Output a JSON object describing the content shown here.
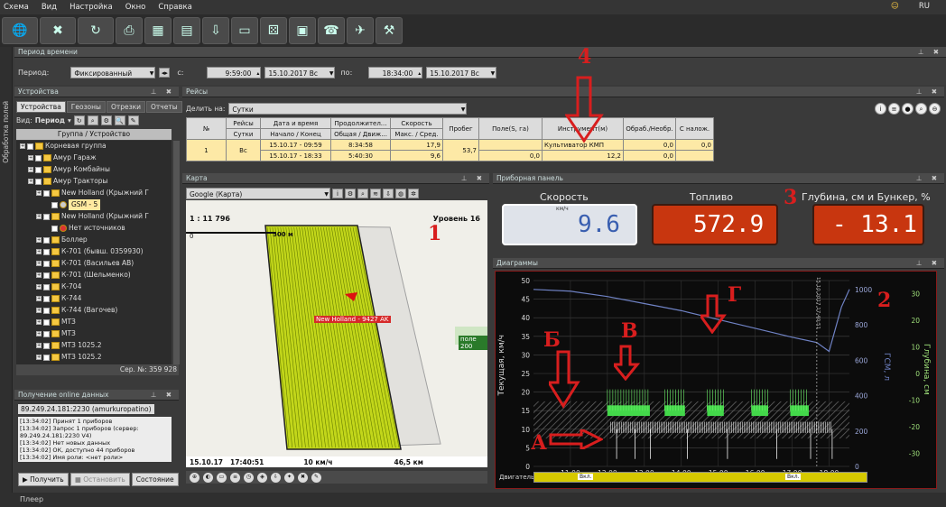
{
  "menu": {
    "items": [
      "Схема",
      "Вид",
      "Настройка",
      "Окно",
      "Справка"
    ],
    "lang": "RU"
  },
  "side_tab": "Обработка полей",
  "period_panel": {
    "title": "Период времени",
    "label": "Период:",
    "mode": "Фиксированный",
    "from_label": "с:",
    "from_time": "9:59:00",
    "from_date": "15.10.2017 Вс",
    "to_label": "по:",
    "to_time": "18:34:00",
    "to_date": "15.10.2017 Вс"
  },
  "devices_panel": {
    "title": "Устройства",
    "tabs": [
      "Устройства",
      "Геозоны",
      "Отрезки",
      "Отчеты"
    ],
    "view_label": "Вид:",
    "view_value": "Период",
    "group_header": "Группа / Устройство",
    "tree": [
      {
        "label": "Корневая группа",
        "level": 0
      },
      {
        "label": "Амур Гараж",
        "level": 1
      },
      {
        "label": "Амур Комбайны",
        "level": 1
      },
      {
        "label": "Амур Тракторы",
        "level": 1
      },
      {
        "label": "New Holland (Крыжний Г",
        "level": 2
      },
      {
        "label": "GSM - 5",
        "level": 3,
        "selected": true
      },
      {
        "label": "New Holland (Крыжний Г",
        "level": 2
      },
      {
        "label": "Нет источников",
        "level": 3
      },
      {
        "label": "Боллер",
        "level": 2
      },
      {
        "label": "К-701 (бывш. 0359930)",
        "level": 2
      },
      {
        "label": "К-701 (Васильев АВ)",
        "level": 2
      },
      {
        "label": "К-701 (Шельменко)",
        "level": 2
      },
      {
        "label": "К-704",
        "level": 2
      },
      {
        "label": "К-744",
        "level": 2
      },
      {
        "label": "К-744 (Вагочев)",
        "level": 2
      },
      {
        "label": "МТЗ",
        "level": 2
      },
      {
        "label": "МТЗ",
        "level": 2
      },
      {
        "label": "МТЗ 1025.2",
        "level": 2
      },
      {
        "label": "МТЗ 1025.2",
        "level": 2
      }
    ],
    "serial": "Сер. №: 359 928"
  },
  "online_panel": {
    "title": "Получение online данных",
    "tab": "89.249.24.181:2230 (amurkuropatino)",
    "log": [
      "[13:34:02] Принят 1 приборов",
      "[13:34:02] Запрос 1 приборов (сервер: 89.249.24.181:2230 V4)",
      "[13:34:02] Нет новых данных",
      "[13:34:02] ОК, доступно 44 приборов",
      "[13:34:02] Имя роли: <нет роли>"
    ],
    "buttons": [
      "Получить",
      "Остановить",
      "Состояние"
    ]
  },
  "trips_panel": {
    "title": "Рейсы",
    "split_label": "Делить на:",
    "split_value": "Сутки",
    "headers_top": [
      "№",
      "Рейсы",
      "Дата и время",
      "Продолжител...",
      "Скорость",
      "Пробег",
      "Поле(S, га)",
      "Инструмент(м)",
      "Обраб./Необр.",
      "С налож."
    ],
    "headers_sub": [
      "",
      "Сутки",
      "Начало / Конец",
      "Общая / Движ...",
      "Макс. / Сред.",
      "",
      "",
      "",
      "",
      ""
    ],
    "row": {
      "num": "1",
      "trip": "Вс",
      "start": "15.10.17 - 09:59",
      "end": "15.10.17 - 18:33",
      "dur_total": "8:34:58",
      "dur_move": "5:40:30",
      "speed_max": "17,9",
      "speed_avg": "9,6",
      "mileage": "53,7",
      "field": "0,0",
      "tool": "Культиватор КМП",
      "tool_w": "12,2",
      "proc": "0,0",
      "unproc": "0,0",
      "overlap": "0,0"
    }
  },
  "map_panel": {
    "title": "Карта",
    "source": "Google (Карта)",
    "scale": "1 : 11 796",
    "level": "Уровень 16",
    "scale_bar": "500 м",
    "zero": "0",
    "vehicle_label": "New Holland - 9427 AK",
    "field_label": "поле 200",
    "status_date": "15.10.17",
    "status_time": "17:40:51",
    "status_speed": "10 км/ч",
    "status_dist": "46,5 км"
  },
  "dashboard": {
    "title": "Приборная панель",
    "speed_title": "Скорость",
    "speed_unit": "км/ч",
    "speed_value": "9.6",
    "fuel_title": "Топливо",
    "fuel_value": "572.9",
    "depth_title": "Глубина, см и Бункер, %",
    "depth_value": "- 13.1",
    "colors": {
      "speed_bg": "#dfe3ea",
      "orange_bg": "#c8360f",
      "digit_speed": "#3a5fb0",
      "digit_orange": "#ffffff"
    }
  },
  "charts_panel": {
    "title": "Диаграммы",
    "left_axis_label": "Текущая, км/ч",
    "right_axis1_label": "ГСМ, л",
    "right_axis2_label": "Глубина, см",
    "engine_label": "Двигатель",
    "engine_state": "Вкл.",
    "marker_label": "15.10.2017 17:40:51",
    "chart_data": {
      "type": "line",
      "x_ticks": [
        "11:00",
        "12:00",
        "13:00",
        "14:00",
        "15:00",
        "16:00",
        "17:00",
        "18:00"
      ],
      "y_left": {
        "ticks": [
          0,
          5,
          10,
          15,
          20,
          25,
          30,
          35,
          40,
          45,
          50
        ],
        "range": [
          0,
          50
        ]
      },
      "y_right1": {
        "ticks": [
          0,
          200,
          400,
          600,
          800,
          1000
        ],
        "range": [
          0,
          1050
        ]
      },
      "y_right2": {
        "ticks": [
          30,
          20,
          10,
          0,
          -10,
          -20,
          -30
        ],
        "range": [
          -35,
          35
        ]
      },
      "series": [
        {
          "name": "ГСМ, л",
          "color": "#6f82c4",
          "x": [
            "10:00",
            "11:00",
            "12:00",
            "13:00",
            "14:00",
            "15:00",
            "16:00",
            "17:00",
            "17:40",
            "18:00",
            "18:20",
            "18:33"
          ],
          "values": [
            1000,
            990,
            960,
            920,
            880,
            830,
            780,
            730,
            700,
            650,
            900,
            1000
          ]
        }
      ]
    }
  },
  "annotations": {
    "n1": "1",
    "n2": "2",
    "n3": "3",
    "n4": "4",
    "a": "А",
    "b": "Б",
    "v": "В",
    "g": "Г"
  },
  "player": "Плеер"
}
